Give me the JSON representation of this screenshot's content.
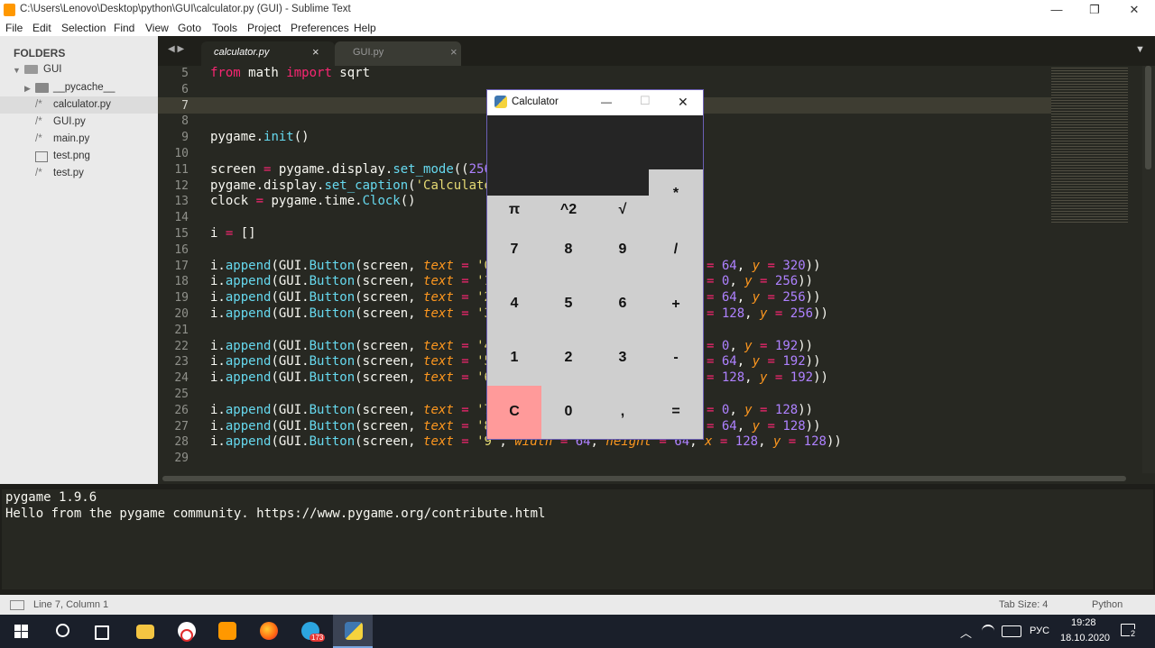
{
  "window": {
    "title": "C:\\Users\\Lenovo\\Desktop\\python\\GUI\\calculator.py (GUI) - Sublime Text",
    "minimize": "—",
    "maximize": "❐",
    "close": "✕"
  },
  "menu": [
    "File",
    "Edit",
    "Selection",
    "Find",
    "View",
    "Goto",
    "Tools",
    "Project",
    "Preferences",
    "Help"
  ],
  "sidebar": {
    "header": "FOLDERS",
    "root": "GUI",
    "items": [
      "__pycache__",
      "calculator.py",
      "GUI.py",
      "main.py",
      "test.png",
      "test.py"
    ],
    "selected": "calculator.py"
  },
  "tabs": [
    {
      "label": "calculator.py",
      "close": "×",
      "active": true
    },
    {
      "label": "GUI.py",
      "close": "×",
      "active": false
    }
  ],
  "editor": {
    "line_numbers": [
      "5",
      "6",
      "7",
      "8",
      "9",
      "10",
      "11",
      "12",
      "13",
      "14",
      "15",
      "16",
      "17",
      "18",
      "19",
      "20",
      "21",
      "22",
      "23",
      "24",
      "25",
      "26",
      "27",
      "28",
      "29"
    ],
    "lines": {
      "l5": "from math import sqrt",
      "l9": "pygame.init()",
      "l11": "screen = pygame.display.set_mode((256",
      "l12": "pygame.display.set_caption('Calculato",
      "l13": "clock = pygame.time.Clock()",
      "l15": "i = []",
      "l17a": "i.append(GUI.Button(screen, text = '0",
      "l17b": "= 64, y = 320))",
      "l18a": "i.append(GUI.Button(screen, text = '1",
      "l18b": "= 0, y = 256))",
      "l19a": "i.append(GUI.Button(screen, text = '2",
      "l19b": "= 64, y = 256))",
      "l20a": "i.append(GUI.Button(screen, text = '3",
      "l20b": "= 128, y = 256))",
      "l22a": "i.append(GUI.Button(screen, text = '4",
      "l22b": "= 0, y = 192))",
      "l23a": "i.append(GUI.Button(screen, text = '5",
      "l23b": "= 64, y = 192))",
      "l24a": "i.append(GUI.Button(screen, text = '6",
      "l24b": "= 128, y = 192))",
      "l26a": "i.append(GUI.Button(screen, text = '7",
      "l26b": "= 0, y = 128))",
      "l27a": "i.append(GUI.Button(screen, text = '8",
      "l27b": "= 64, y = 128))",
      "l28": "i.append(GUI.Button(screen, text = '9', width = 64, height = 64, x = 128, y = 128))"
    }
  },
  "console": [
    "pygame 1.9.6",
    "Hello from the pygame community. https://www.pygame.org/contribute.html"
  ],
  "status": {
    "position": "Line 7, Column 1",
    "tab_size": "Tab Size: 4",
    "syntax": "Python"
  },
  "calculator": {
    "title": "Calculator",
    "minimize": "—",
    "maximize": "☐",
    "close": "✕",
    "buttons": {
      "mul": "*",
      "pi": "π",
      "pow": "^2",
      "sqrt": "√",
      "b7": "7",
      "b8": "8",
      "b9": "9",
      "div": "/",
      "b4": "4",
      "b5": "5",
      "b6": "6",
      "plus": "+",
      "b1": "1",
      "b2": "2",
      "b3": "3",
      "minus": "-",
      "clear": "C",
      "b0": "0",
      "comma": ",",
      "eq": "="
    }
  },
  "taskbar": {
    "lang": "РУС",
    "time": "19:28",
    "date": "18.10.2020",
    "telegram_badge": "173",
    "notif_count": "2",
    "icons": [
      "windows-start-icon",
      "search-icon",
      "task-view-icon",
      "file-explorer-icon",
      "yandex-browser-icon",
      "sublime-text-icon",
      "firefox-icon",
      "telegram-icon",
      "python-icon"
    ]
  },
  "colors": {
    "editor_bg": "#272822",
    "keyword": "#f92672",
    "function": "#66d9ef",
    "string": "#e6db74",
    "number": "#ae81ff",
    "argument": "#fd971f",
    "clear_button": "#ff9a9a",
    "calc_display": "#252525"
  }
}
